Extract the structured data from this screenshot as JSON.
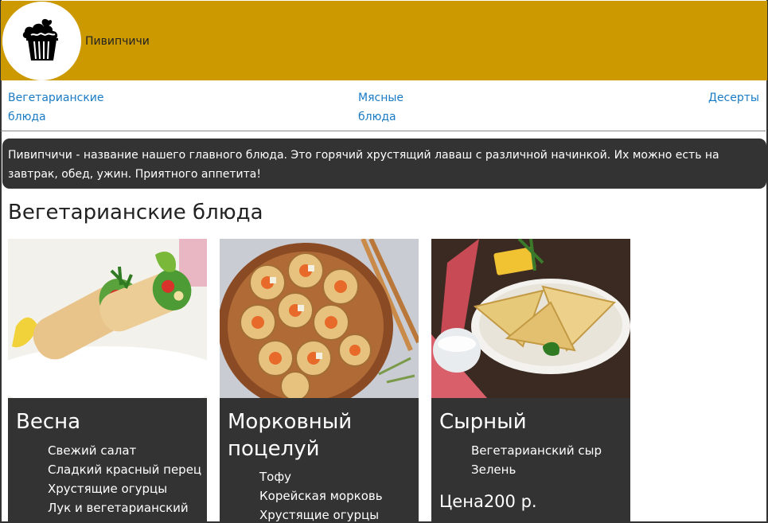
{
  "header": {
    "brand": "Пивипчичи",
    "logo_icon": "cupcake-icon",
    "bg_color": "#cc9900"
  },
  "nav": {
    "items": [
      "Вегетарианские блюда",
      "Мясные блюда",
      "Десерты"
    ]
  },
  "intro": {
    "text": "Пивипчичи - название нашего главного блюда. Это горячий хрустящий лаваш с различной начинкой. Их можно есть на завтрак, обед, ужин. Приятного аппетита!"
  },
  "section": {
    "title": "Вегетарианские блюда"
  },
  "cards": [
    {
      "title": "Весна",
      "ingredients": [
        "Свежий салат",
        "Сладкий красный перец",
        "Хрустящие огурцы",
        "Лук и вегетарианский"
      ]
    },
    {
      "title": "Морковный поцелуй",
      "ingredients": [
        "Тофу",
        "Корейская морковь",
        "Хрустящие огурцы"
      ]
    },
    {
      "title": "Сырный",
      "ingredients": [
        "Вегетарианский сыр",
        "Зелень"
      ],
      "price": "Цена200 р."
    }
  ]
}
